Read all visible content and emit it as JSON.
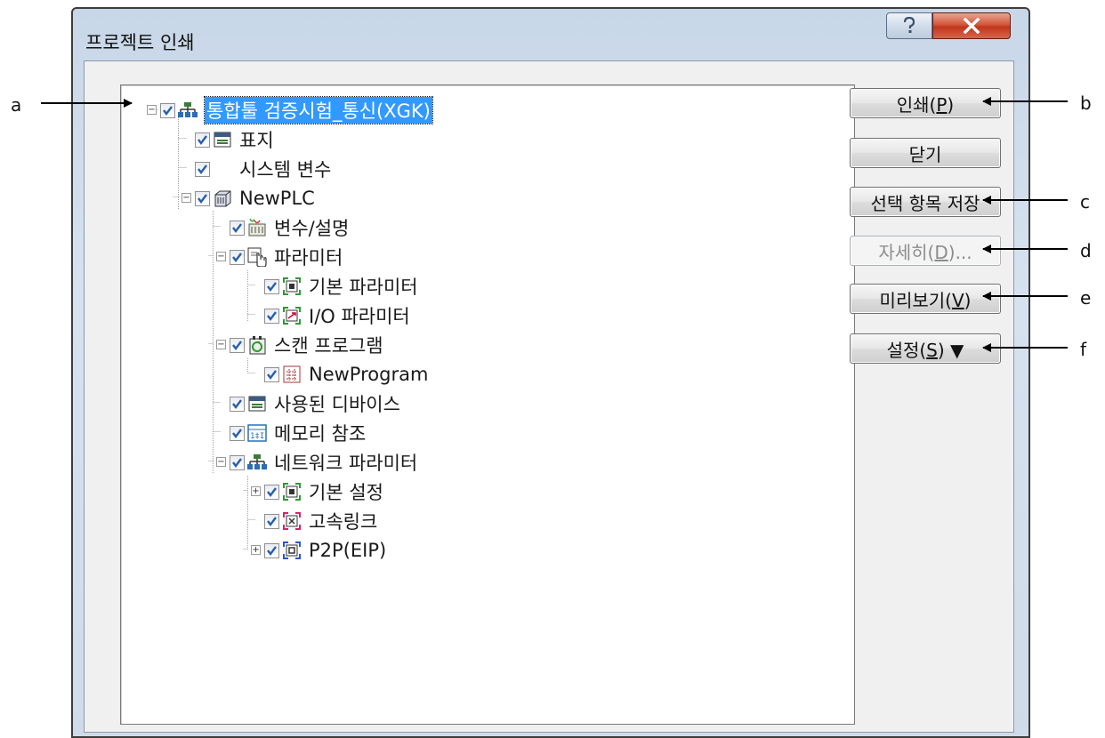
{
  "dialog": {
    "title": "프로젝트 인쇄",
    "help_label": "?",
    "close_label": "X"
  },
  "tree": [
    {
      "label": "통합툴 검증시험_통신(XGK)",
      "checked": true,
      "icon": "network-icon",
      "selected": true,
      "expander": "minus"
    },
    {
      "label": "표지",
      "checked": true,
      "icon": "cover-icon"
    },
    {
      "label": "시스템 변수",
      "checked": true,
      "icon": ""
    },
    {
      "label": "NewPLC",
      "checked": true,
      "icon": "plc-icon",
      "expander": "minus"
    },
    {
      "label": "변수/설명",
      "checked": true,
      "icon": "variable-icon"
    },
    {
      "label": "파라미터",
      "checked": true,
      "icon": "parameter-icon",
      "expander": "minus"
    },
    {
      "label": "기본 파라미터",
      "checked": true,
      "icon": "basic-param-icon"
    },
    {
      "label": "I/O 파라미터",
      "checked": true,
      "icon": "io-param-icon"
    },
    {
      "label": "스캔 프로그램",
      "checked": true,
      "icon": "scan-program-icon",
      "expander": "minus"
    },
    {
      "label": "NewProgram",
      "checked": true,
      "icon": "program-icon"
    },
    {
      "label": "사용된 디바이스",
      "checked": true,
      "icon": "device-icon"
    },
    {
      "label": "메모리 참조",
      "checked": true,
      "icon": "memory-icon"
    },
    {
      "label": "네트워크 파라미터",
      "checked": true,
      "icon": "network-param-icon",
      "expander": "minus"
    },
    {
      "label": "기본 설정",
      "checked": true,
      "icon": "basic-setting-icon",
      "expander": "plus"
    },
    {
      "label": "고속링크",
      "checked": true,
      "icon": "highspeed-link-icon"
    },
    {
      "label": "P2P(EIP)",
      "checked": true,
      "icon": "p2p-icon",
      "expander": "plus"
    }
  ],
  "buttons": {
    "print": {
      "text": "인쇄(",
      "key": "P",
      "tail": ")"
    },
    "close": {
      "text": "닫기",
      "key": "",
      "tail": ""
    },
    "save": {
      "text": "선택 항목 저장",
      "key": "",
      "tail": ""
    },
    "detail": {
      "text": "자세히(",
      "key": "D",
      "tail": ")..."
    },
    "preview": {
      "text": "미리보기(",
      "key": "V",
      "tail": ")"
    },
    "settings": {
      "text": "설정(",
      "key": "S",
      "tail": ") ▼"
    }
  },
  "callouts": {
    "a": "a",
    "b": "b",
    "c": "c",
    "d": "d",
    "e": "e",
    "f": "f"
  },
  "colors": {
    "selection": "#3399ff",
    "check": "#2a5fa8",
    "close_button": "#c2361c"
  }
}
